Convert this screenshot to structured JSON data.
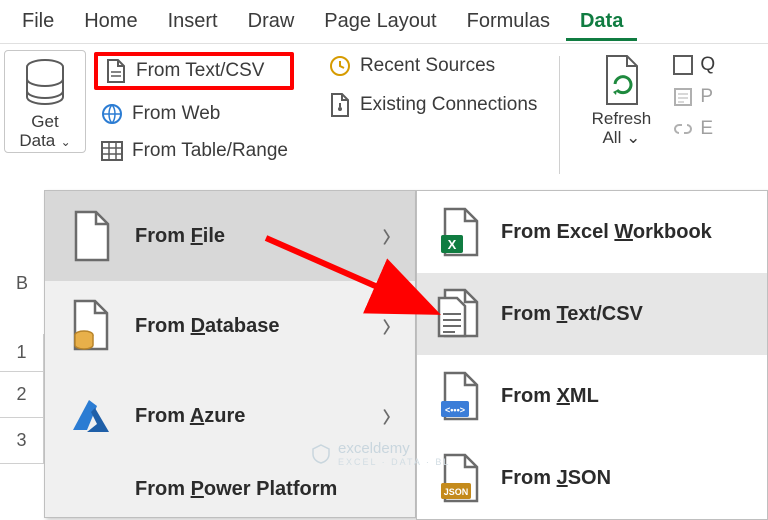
{
  "tabs": {
    "file": "File",
    "home": "Home",
    "insert": "Insert",
    "draw": "Draw",
    "pagelayout": "Page Layout",
    "formulas": "Formulas",
    "data": "Data"
  },
  "ribbon": {
    "getdata": {
      "line1": "Get",
      "line2": "Data"
    },
    "from_text_csv": "From Text/CSV",
    "from_web": "From Web",
    "from_table_range": "From Table/Range",
    "recent_sources": "Recent Sources",
    "existing_connections": "Existing Connections",
    "refresh": {
      "line1": "Refresh",
      "line2": "All"
    },
    "queries_short": "Q",
    "properties_short": "P",
    "editlinks_short": "E"
  },
  "menu1": {
    "from_file_pre": "From ",
    "from_file_u": "F",
    "from_file_post": "ile",
    "from_database_pre": "From ",
    "from_database_u": "D",
    "from_database_post": "atabase",
    "from_azure_pre": "From ",
    "from_azure_u": "A",
    "from_azure_post": "zure",
    "from_power_pre": "From ",
    "from_power_u": "P",
    "from_power_post": "ower Platform"
  },
  "menu2": {
    "excel_pre": "From Excel ",
    "excel_u": "W",
    "excel_post": "orkbook",
    "csv_pre": "From ",
    "csv_u": "T",
    "csv_post": "ext/CSV",
    "xml_pre": "From ",
    "xml_u": "X",
    "xml_post": "ML",
    "json_pre": "From ",
    "json_u": "J",
    "json_post": "SON"
  },
  "rowhdr": {
    "B": "B",
    "r1": "1",
    "r2": "2",
    "r3": "3"
  },
  "watermark": {
    "brand": "exceldemy",
    "sub": "EXCEL · DATA · BL"
  }
}
